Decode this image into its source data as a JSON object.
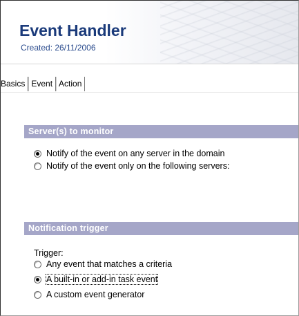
{
  "header": {
    "title": "Event Handler",
    "created": "Created: 26/11/2006"
  },
  "tabs": [
    {
      "label": "Basics",
      "active": true
    },
    {
      "label": "Event",
      "active": false
    },
    {
      "label": "Action",
      "active": false
    }
  ],
  "servers_section": {
    "title": "Server(s) to monitor",
    "options": [
      {
        "label": "Notify of the event on any server in the domain",
        "checked": true
      },
      {
        "label": "Notify of the event only on the following servers:",
        "checked": false
      }
    ]
  },
  "notification_section": {
    "title": "Notification trigger",
    "trigger_label": "Trigger:",
    "options": [
      {
        "label": "Any event that matches a criteria",
        "checked": false
      },
      {
        "label": "A built-in or add-in task event",
        "checked": true
      },
      {
        "label": "A custom event generator",
        "checked": false
      }
    ]
  },
  "colors": {
    "title": "#1a3a7a",
    "section_bar": "#a5a6c8"
  }
}
